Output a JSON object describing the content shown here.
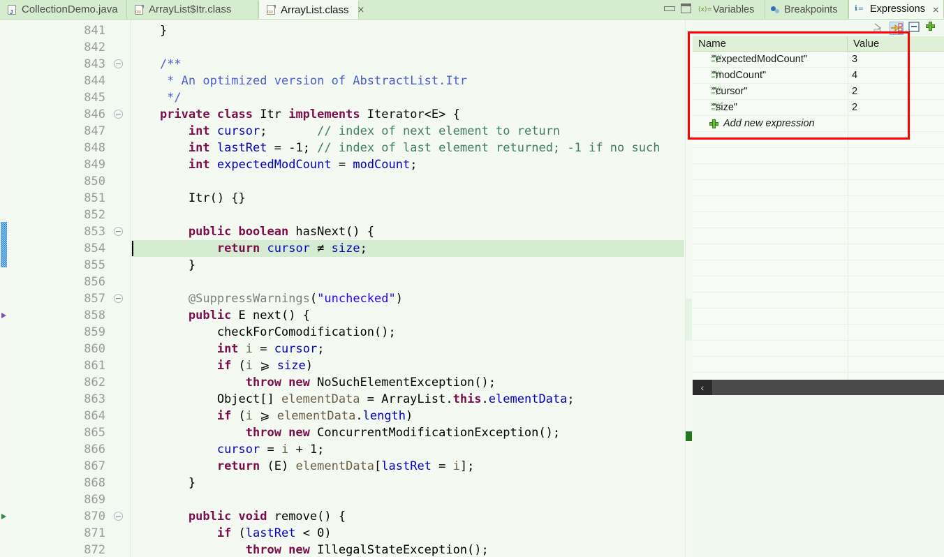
{
  "window": {
    "minimize_label": "Minimize",
    "maximize_label": "Maximize"
  },
  "editor": {
    "tabs": [
      {
        "label": "CollectionDemo.java",
        "icon": "java-file-icon",
        "active": false,
        "closable": false
      },
      {
        "label": "ArrayList$Itr.class",
        "icon": "class-file-icon",
        "active": false,
        "closable": false
      },
      {
        "label": "ArrayList.class",
        "icon": "class-file-icon",
        "active": true,
        "closable": true,
        "close_label": "⨯"
      }
    ],
    "highlighted_line": 854,
    "lines": [
      {
        "num": "841",
        "fold": false,
        "marker": null,
        "tokens": [
          {
            "t": "    }",
            "c": "pl"
          }
        ]
      },
      {
        "num": "842",
        "fold": false,
        "marker": null,
        "tokens": []
      },
      {
        "num": "843",
        "fold": true,
        "marker": null,
        "tokens": [
          {
            "t": "    ",
            "c": "pl"
          },
          {
            "t": "/**",
            "c": "jd"
          }
        ]
      },
      {
        "num": "844",
        "fold": false,
        "marker": null,
        "tokens": [
          {
            "t": "     * An optimized version of AbstractList.Itr",
            "c": "jd"
          }
        ]
      },
      {
        "num": "845",
        "fold": false,
        "marker": null,
        "tokens": [
          {
            "t": "     */",
            "c": "jd"
          }
        ]
      },
      {
        "num": "846",
        "fold": true,
        "marker": null,
        "tokens": [
          {
            "t": "    ",
            "c": "pl"
          },
          {
            "t": "private class",
            "c": "k"
          },
          {
            "t": " Itr ",
            "c": "pl"
          },
          {
            "t": "implements",
            "c": "k"
          },
          {
            "t": " Iterator<E> {",
            "c": "pl"
          }
        ]
      },
      {
        "num": "847",
        "fold": false,
        "marker": null,
        "tokens": [
          {
            "t": "        ",
            "c": "pl"
          },
          {
            "t": "int",
            "c": "k"
          },
          {
            "t": " ",
            "c": "pl"
          },
          {
            "t": "cursor",
            "c": "fl"
          },
          {
            "t": ";       ",
            "c": "pl"
          },
          {
            "t": "// index of next element to return",
            "c": "cm"
          }
        ]
      },
      {
        "num": "848",
        "fold": false,
        "marker": null,
        "tokens": [
          {
            "t": "        ",
            "c": "pl"
          },
          {
            "t": "int",
            "c": "k"
          },
          {
            "t": " ",
            "c": "pl"
          },
          {
            "t": "lastRet",
            "c": "fl"
          },
          {
            "t": " = -1; ",
            "c": "pl"
          },
          {
            "t": "// index of last element returned; -1 if no such",
            "c": "cm"
          }
        ]
      },
      {
        "num": "849",
        "fold": false,
        "marker": null,
        "tokens": [
          {
            "t": "        ",
            "c": "pl"
          },
          {
            "t": "int",
            "c": "k"
          },
          {
            "t": " ",
            "c": "pl"
          },
          {
            "t": "expectedModCount",
            "c": "fl"
          },
          {
            "t": " = ",
            "c": "pl"
          },
          {
            "t": "modCount",
            "c": "fl"
          },
          {
            "t": ";",
            "c": "pl"
          }
        ]
      },
      {
        "num": "850",
        "fold": false,
        "marker": null,
        "tokens": []
      },
      {
        "num": "851",
        "fold": false,
        "marker": null,
        "tokens": [
          {
            "t": "        Itr() {}",
            "c": "pl"
          }
        ]
      },
      {
        "num": "852",
        "fold": false,
        "marker": null,
        "tokens": []
      },
      {
        "num": "853",
        "fold": true,
        "marker": null,
        "tokens": [
          {
            "t": "        ",
            "c": "pl"
          },
          {
            "t": "public boolean",
            "c": "k"
          },
          {
            "t": " hasNext() {",
            "c": "pl"
          }
        ]
      },
      {
        "num": "854",
        "fold": false,
        "marker": null,
        "tokens": [
          {
            "t": "            ",
            "c": "pl"
          },
          {
            "t": "return",
            "c": "k"
          },
          {
            "t": " ",
            "c": "pl"
          },
          {
            "t": "cursor",
            "c": "fl"
          },
          {
            "t": " ≠ ",
            "c": "pl"
          },
          {
            "t": "size",
            "c": "fl"
          },
          {
            "t": ";",
            "c": "pl"
          }
        ]
      },
      {
        "num": "855",
        "fold": false,
        "marker": null,
        "tokens": [
          {
            "t": "        }",
            "c": "pl"
          }
        ]
      },
      {
        "num": "856",
        "fold": false,
        "marker": null,
        "tokens": []
      },
      {
        "num": "857",
        "fold": true,
        "marker": null,
        "tokens": [
          {
            "t": "        ",
            "c": "pl"
          },
          {
            "t": "@SuppressWarnings",
            "c": "an"
          },
          {
            "t": "(",
            "c": "pl"
          },
          {
            "t": "\"unchecked\"",
            "c": "st"
          },
          {
            "t": ")",
            "c": "pl"
          }
        ]
      },
      {
        "num": "858",
        "fold": false,
        "marker": "purple-triangle-marker",
        "tokens": [
          {
            "t": "        ",
            "c": "pl"
          },
          {
            "t": "public",
            "c": "k"
          },
          {
            "t": " E next() {",
            "c": "pl"
          }
        ]
      },
      {
        "num": "859",
        "fold": false,
        "marker": null,
        "tokens": [
          {
            "t": "            checkForComodification();",
            "c": "pl"
          }
        ]
      },
      {
        "num": "860",
        "fold": false,
        "marker": null,
        "tokens": [
          {
            "t": "            ",
            "c": "pl"
          },
          {
            "t": "int",
            "c": "k"
          },
          {
            "t": " ",
            "c": "pl"
          },
          {
            "t": "i",
            "c": "lv"
          },
          {
            "t": " = ",
            "c": "pl"
          },
          {
            "t": "cursor",
            "c": "fl"
          },
          {
            "t": ";",
            "c": "pl"
          }
        ]
      },
      {
        "num": "861",
        "fold": false,
        "marker": null,
        "tokens": [
          {
            "t": "            ",
            "c": "pl"
          },
          {
            "t": "if",
            "c": "k"
          },
          {
            "t": " (",
            "c": "pl"
          },
          {
            "t": "i",
            "c": "lv"
          },
          {
            "t": " ⩾ ",
            "c": "pl"
          },
          {
            "t": "size",
            "c": "fl"
          },
          {
            "t": ")",
            "c": "pl"
          }
        ]
      },
      {
        "num": "862",
        "fold": false,
        "marker": null,
        "tokens": [
          {
            "t": "                ",
            "c": "pl"
          },
          {
            "t": "throw new",
            "c": "k"
          },
          {
            "t": " NoSuchElementException();",
            "c": "pl"
          }
        ]
      },
      {
        "num": "863",
        "fold": false,
        "marker": null,
        "tokens": [
          {
            "t": "            Object[] ",
            "c": "pl"
          },
          {
            "t": "elementData",
            "c": "lv"
          },
          {
            "t": " = ArrayList.",
            "c": "pl"
          },
          {
            "t": "this",
            "c": "k"
          },
          {
            "t": ".",
            "c": "pl"
          },
          {
            "t": "elementData",
            "c": "fl"
          },
          {
            "t": ";",
            "c": "pl"
          }
        ]
      },
      {
        "num": "864",
        "fold": false,
        "marker": null,
        "tokens": [
          {
            "t": "            ",
            "c": "pl"
          },
          {
            "t": "if",
            "c": "k"
          },
          {
            "t": " (",
            "c": "pl"
          },
          {
            "t": "i",
            "c": "lv"
          },
          {
            "t": " ⩾ ",
            "c": "pl"
          },
          {
            "t": "elementData",
            "c": "lv"
          },
          {
            "t": ".",
            "c": "pl"
          },
          {
            "t": "length",
            "c": "fl"
          },
          {
            "t": ")",
            "c": "pl"
          }
        ]
      },
      {
        "num": "865",
        "fold": false,
        "marker": null,
        "tokens": [
          {
            "t": "                ",
            "c": "pl"
          },
          {
            "t": "throw new",
            "c": "k"
          },
          {
            "t": " ConcurrentModificationException();",
            "c": "pl"
          }
        ]
      },
      {
        "num": "866",
        "fold": false,
        "marker": null,
        "tokens": [
          {
            "t": "            ",
            "c": "pl"
          },
          {
            "t": "cursor",
            "c": "fl"
          },
          {
            "t": " = ",
            "c": "pl"
          },
          {
            "t": "i",
            "c": "lv"
          },
          {
            "t": " + 1;",
            "c": "pl"
          }
        ]
      },
      {
        "num": "867",
        "fold": false,
        "marker": null,
        "tokens": [
          {
            "t": "            ",
            "c": "pl"
          },
          {
            "t": "return",
            "c": "k"
          },
          {
            "t": " (E) ",
            "c": "pl"
          },
          {
            "t": "elementData",
            "c": "lv"
          },
          {
            "t": "[",
            "c": "pl"
          },
          {
            "t": "lastRet",
            "c": "fl"
          },
          {
            "t": " = ",
            "c": "pl"
          },
          {
            "t": "i",
            "c": "lv"
          },
          {
            "t": "];",
            "c": "pl"
          }
        ]
      },
      {
        "num": "868",
        "fold": false,
        "marker": null,
        "tokens": [
          {
            "t": "        }",
            "c": "pl"
          }
        ]
      },
      {
        "num": "869",
        "fold": false,
        "marker": null,
        "tokens": []
      },
      {
        "num": "870",
        "fold": true,
        "marker": "green-triangle-marker",
        "tokens": [
          {
            "t": "        ",
            "c": "pl"
          },
          {
            "t": "public void",
            "c": "k"
          },
          {
            "t": " remove() {",
            "c": "pl"
          }
        ]
      },
      {
        "num": "871",
        "fold": false,
        "marker": null,
        "tokens": [
          {
            "t": "            ",
            "c": "pl"
          },
          {
            "t": "if",
            "c": "k"
          },
          {
            "t": " (",
            "c": "pl"
          },
          {
            "t": "lastRet",
            "c": "fl"
          },
          {
            "t": " < 0)",
            "c": "pl"
          }
        ]
      },
      {
        "num": "872",
        "fold": false,
        "marker": null,
        "tokens": [
          {
            "t": "                ",
            "c": "pl"
          },
          {
            "t": "throw new",
            "c": "k"
          },
          {
            "t": " IllegalStateException();",
            "c": "pl"
          }
        ]
      }
    ]
  },
  "debug": {
    "tabs": [
      {
        "label": "Variables",
        "icon": "variables-icon",
        "active": false,
        "closable": false
      },
      {
        "label": "Breakpoints",
        "icon": "breakpoints-icon",
        "active": false,
        "closable": false
      },
      {
        "label": "Expressions",
        "icon": "expressions-icon",
        "active": true,
        "closable": true,
        "close_label": "⨯"
      }
    ],
    "toolbar": [
      {
        "name": "show-logical-structure-button",
        "selected": false
      },
      {
        "name": "collapse-all-button",
        "selected": true
      },
      {
        "name": "remove-selected-expressions-button",
        "selected": false
      },
      {
        "name": "add-new-expression-button",
        "selected": false
      }
    ],
    "columns": {
      "name": "Name",
      "value": "Value"
    },
    "rows": [
      {
        "name": "\"expectedModCount\"",
        "value": "3",
        "icon": "expression-icon"
      },
      {
        "name": "\"modCount\"",
        "value": "4",
        "icon": "expression-icon"
      },
      {
        "name": "\"cursor\"",
        "value": "2",
        "icon": "expression-icon"
      },
      {
        "name": "\"size\"",
        "value": "2",
        "icon": "expression-icon"
      }
    ],
    "add_row": {
      "label": "Add new expression",
      "icon": "plus-icon"
    },
    "hscroll": {
      "left_arrow": "‹"
    },
    "highlight_color": "#ff0000"
  }
}
